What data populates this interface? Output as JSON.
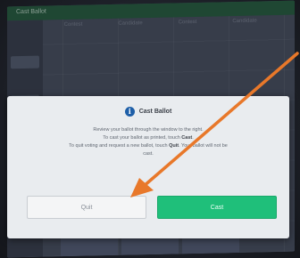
{
  "screen": {
    "title": "Cast Ballot"
  },
  "background_text": {
    "col1": "Contest",
    "col2": "Candidate",
    "col3": "Contest",
    "col4": "Candidate"
  },
  "modal": {
    "title": "Cast Ballot",
    "icon": "info-icon",
    "line1": "Review your ballot through the window to the right.",
    "line2": "To cast your ballot as printed, touch Cast.",
    "line3": "To quit voting and request a new ballot, touch Quit. Your ballot will not be",
    "line4": "cast."
  },
  "buttons": {
    "quit": "Quit",
    "cast": "Cast"
  },
  "colors": {
    "topbar": "#26623e",
    "cast_button": "#1fbf7a",
    "arrow": "#e8782a",
    "info_icon": "#1e5fa8"
  }
}
